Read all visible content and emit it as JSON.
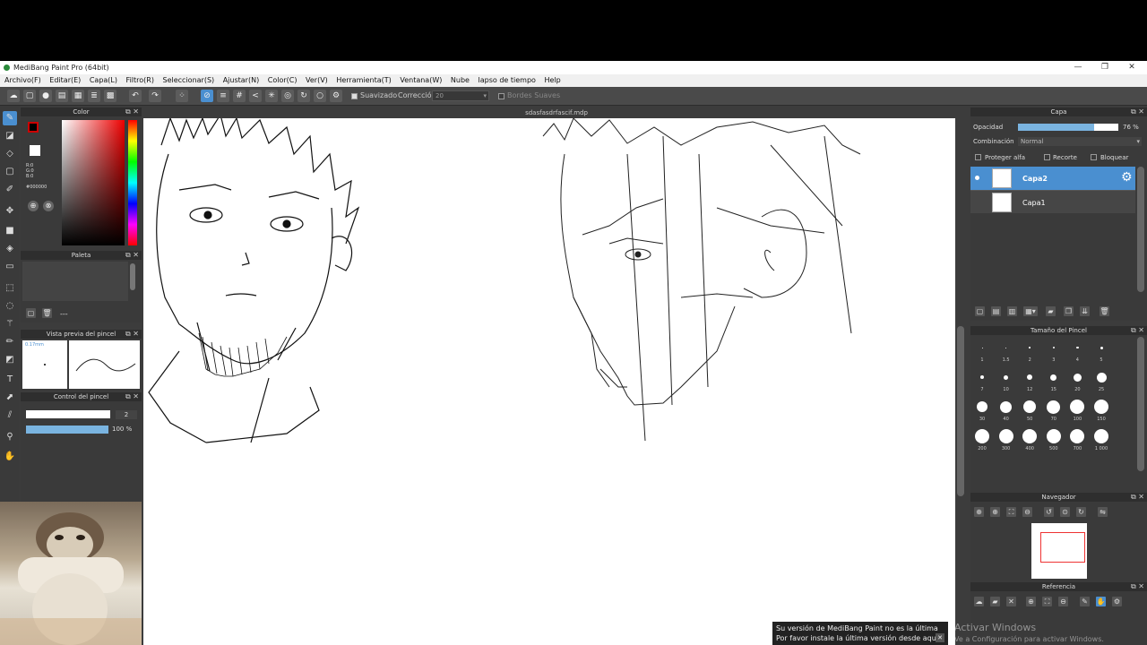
{
  "window": {
    "title": "MediBang Paint Pro (64bit)",
    "min": "—",
    "max": "❐",
    "close": "✕"
  },
  "menu": [
    "Archivo(F)",
    "Editar(E)",
    "Capa(L)",
    "Filtro(R)",
    "Seleccionar(S)",
    "Ajustar(N)",
    "Color(C)",
    "Ver(V)",
    "Herramienta(T)",
    "Ventana(W)",
    "Nube",
    "lapso de tiempo",
    "Help"
  ],
  "toolbar": {
    "suavizado_label": "Suavizado",
    "correccion_label": "Corrección",
    "correccion_value": "20",
    "bordes_label": "Bordes Suaves"
  },
  "document": {
    "tab_name": "sdasfasdrfascif.mdp"
  },
  "color_panel": {
    "title": "Color",
    "r": "R:0",
    "g": "G:0",
    "b": "B:0",
    "hex": "#000000",
    "fg": "#000000"
  },
  "palette_panel": {
    "title": "Paleta",
    "more": "---"
  },
  "brush_preview": {
    "title": "Vista previa del pincel",
    "size": "0.17mm"
  },
  "brush_control": {
    "title": "Control del pincel",
    "size_value": "2",
    "opacity_value": "100 %"
  },
  "layers_panel": {
    "title": "Capa",
    "opacity_label": "Opacidad",
    "opacity_value": "76 %",
    "opacity_fraction": 0.76,
    "blend_label": "Combinación",
    "blend_value": "Normal",
    "protect_alpha": "Proteger alfa",
    "clipping": "Recorte",
    "lock": "Bloquear",
    "layers": [
      {
        "name": "Capa2",
        "selected": true
      },
      {
        "name": "Capa1",
        "selected": false
      }
    ]
  },
  "brush_size_panel": {
    "title": "Tamaño del Pincel",
    "sizes": [
      "1",
      "1.5",
      "2",
      "3",
      "4",
      "5",
      "7",
      "10",
      "12",
      "15",
      "20",
      "25",
      "30",
      "40",
      "50",
      "70",
      "100",
      "150",
      "200",
      "300",
      "400",
      "500",
      "700",
      "1 000"
    ]
  },
  "navigator_panel": {
    "title": "Navegador"
  },
  "reference_panel": {
    "title": "Referencia"
  },
  "notification": {
    "line1": "Su versión de MediBang Paint no es la última",
    "line2": "Por favor instale la última versión desde aquí"
  },
  "watermark": {
    "line1": "Activar Windows",
    "line2": "Ve a Configuración para activar Windows."
  }
}
